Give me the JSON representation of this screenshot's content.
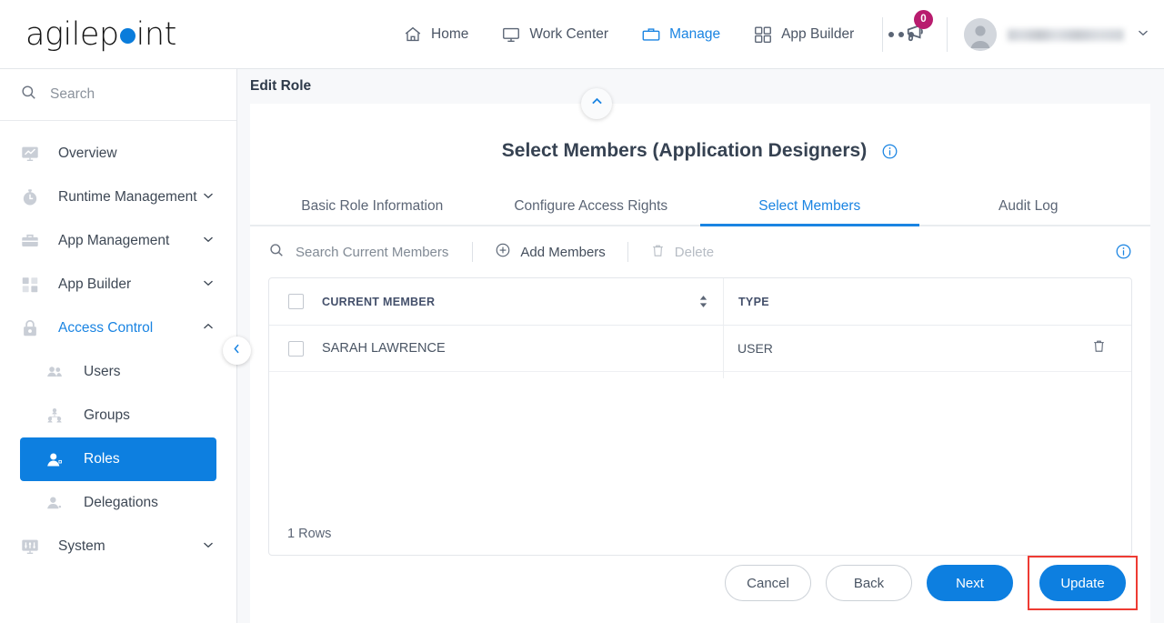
{
  "brand": {
    "name_part1": "agilep",
    "name_dot": "o",
    "name_part2": "int",
    "accent_color": "#0a7cdb"
  },
  "topnav": {
    "items": [
      {
        "label": "Home",
        "icon": "home-icon",
        "active": false
      },
      {
        "label": "Work Center",
        "icon": "monitor-icon",
        "active": false
      },
      {
        "label": "Manage",
        "icon": "briefcase-icon",
        "active": true
      },
      {
        "label": "App Builder",
        "icon": "grid-icon",
        "active": false
      }
    ],
    "more_label": "",
    "notification_count": "0",
    "notification_icon": "megaphone-icon",
    "badge_color": "#b81c6e",
    "user_name": "",
    "user_icon": "avatar-icon",
    "chevron_icon": "chevron-down-icon"
  },
  "sidebar": {
    "search_placeholder": "Search",
    "items": [
      {
        "label": "Overview",
        "icon": "chart-monitor-icon",
        "expandable": false,
        "active": false
      },
      {
        "label": "Runtime Management",
        "icon": "stopwatch-icon",
        "expandable": true,
        "active": false
      },
      {
        "label": "App Management",
        "icon": "briefcase-icon",
        "expandable": true,
        "active": false
      },
      {
        "label": "App Builder",
        "icon": "grid-check-icon",
        "expandable": true,
        "active": false
      },
      {
        "label": "Access Control",
        "icon": "lock-icon",
        "expandable": true,
        "active": true,
        "expanded": true
      }
    ],
    "sub_items": [
      {
        "label": "Users",
        "icon": "users-icon",
        "selected": false
      },
      {
        "label": "Groups",
        "icon": "group-tree-icon",
        "selected": false
      },
      {
        "label": "Roles",
        "icon": "user-role-icon",
        "selected": true
      },
      {
        "label": "Delegations",
        "icon": "user-delegate-icon",
        "selected": false
      }
    ],
    "footer_items": [
      {
        "label": "System",
        "icon": "system-monitor-icon",
        "expandable": true
      }
    ],
    "collapse_icon": "chevron-left-icon",
    "selected_color": "#0d7fe0"
  },
  "page": {
    "breadcrumb_title": "Edit Role",
    "collapse_icon": "chevron-up-icon",
    "card_title": "Select Members (Application Designers)",
    "title_info_icon": "info-icon",
    "tabs": [
      {
        "label": "Basic Role Information",
        "active": false
      },
      {
        "label": "Configure Access Rights",
        "active": false
      },
      {
        "label": "Select Members",
        "active": true
      },
      {
        "label": "Audit Log",
        "active": false
      }
    ]
  },
  "toolbar": {
    "search_placeholder": "Search Current Members",
    "search_icon": "search-icon",
    "add_members_label": "Add Members",
    "add_members_icon": "plus-circle-icon",
    "delete_label": "Delete",
    "delete_icon": "trash-icon",
    "delete_disabled": true,
    "info_icon": "info-icon"
  },
  "table": {
    "columns": [
      {
        "label": "CURRENT MEMBER",
        "sortable": true
      },
      {
        "label": "TYPE",
        "sortable": false
      }
    ],
    "rows": [
      {
        "member": "SARAH LAWRENCE",
        "type": "USER",
        "delete_icon": "trash-icon",
        "checked": false
      }
    ],
    "select_all_checked": false,
    "footer_text": "1 Rows"
  },
  "footer": {
    "buttons": [
      {
        "label": "Cancel",
        "style": "outline",
        "highlighted": false
      },
      {
        "label": "Back",
        "style": "outline",
        "highlighted": false
      },
      {
        "label": "Next",
        "style": "primary",
        "highlighted": false
      },
      {
        "label": "Update",
        "style": "primary",
        "highlighted": true
      }
    ],
    "highlight_color": "#ee3b33"
  }
}
